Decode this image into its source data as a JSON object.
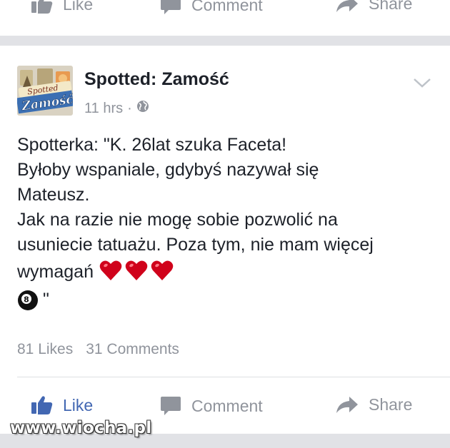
{
  "colors": {
    "accent": "#4267b2",
    "muted": "#90949c",
    "text": "#1d2129",
    "separator": "#e1e2e6"
  },
  "top_actions": {
    "like_label": "Like",
    "comment_label": "Comment",
    "share_label": "Share"
  },
  "post": {
    "page_name": "Spotted: Zamość",
    "time": "11 hrs",
    "separator": "·",
    "audience_icon": "globe-icon",
    "avatar_text_top": "Spotted",
    "avatar_text_bottom": "Zamość",
    "lines": [
      "Spotterka: \"K. 26lat szuka Faceta!",
      "Byłoby wspaniale, gdybyś nazywał się",
      "Mateusz.",
      "Jak na razie nie mogę sobie pozwolić na",
      "usuniecie tatuażu. Poza tym, nie mam więcej",
      "wymagań"
    ],
    "heart_icon": "heart-emoji-icon",
    "ball_icon": "eight-ball-emoji-icon",
    "closing_quote": "\""
  },
  "stats": {
    "likes": "81 Likes",
    "comments": "31 Comments"
  },
  "bottom_actions": {
    "like_label": "Like",
    "comment_label": "Comment",
    "share_label": "Share"
  },
  "watermark": "www.wiocha.pl"
}
